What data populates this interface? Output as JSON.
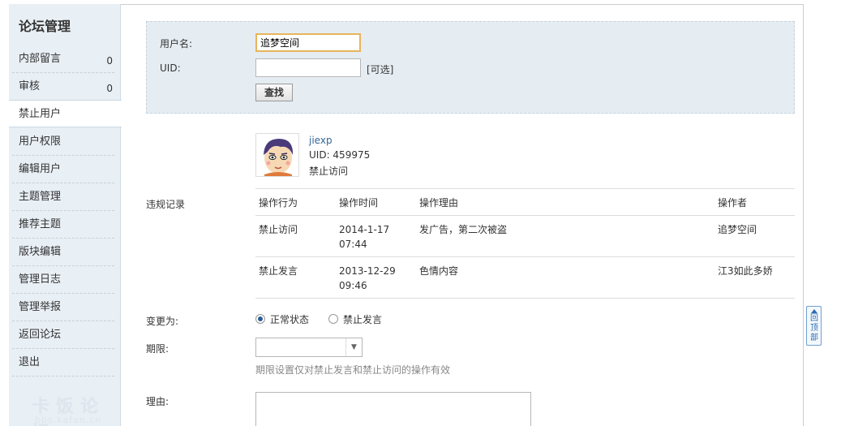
{
  "sidebar": {
    "title": "论坛管理",
    "items": [
      {
        "label": "内部留言",
        "count": "0"
      },
      {
        "label": "审核",
        "count": "0"
      },
      {
        "label": "禁止用户"
      },
      {
        "label": "用户权限"
      },
      {
        "label": "编辑用户"
      },
      {
        "label": "主题管理"
      },
      {
        "label": "推荐主题"
      },
      {
        "label": "版块编辑"
      },
      {
        "label": "管理日志"
      },
      {
        "label": "管理举报"
      },
      {
        "label": "返回论坛"
      },
      {
        "label": "退出"
      }
    ],
    "active_item": "禁止用户",
    "watermark": "卡饭论坛",
    "watermark_url": "bbs.kafan.cn"
  },
  "search": {
    "username_label": "用户名:",
    "username_value": "追梦空间",
    "uid_label": "UID:",
    "uid_value": "",
    "uid_hint": "[可选]",
    "search_button": "查找"
  },
  "user": {
    "name": "jiexp",
    "uid": "UID: 459975",
    "status": "禁止访问"
  },
  "records": {
    "section_label": "违规记录",
    "columns": [
      "操作行为",
      "操作时间",
      "操作理由",
      "操作者"
    ],
    "rows": [
      {
        "action": "禁止访问",
        "date": "2014-1-17",
        "time": "07:44",
        "reason": "发广告，第二次被盗",
        "operator": "追梦空间"
      },
      {
        "action": "禁止发言",
        "date": "2013-12-29",
        "time": "09:46",
        "reason": "色情内容",
        "operator": "江3如此多娇"
      }
    ]
  },
  "form": {
    "change_label": "变更为:",
    "options": [
      "正常状态",
      "禁止发言"
    ],
    "selected_option": "正常状态",
    "period_label": "期限:",
    "period_value": "",
    "period_hint": "期限设置仅对禁止发言和禁止访问的操作有效",
    "reason_label": "理由:"
  },
  "back_to_top": "回顶部",
  "colors": {
    "link": "#336699",
    "sidebar_bg": "#e8eff5",
    "panel_bg": "#e5edf3",
    "focus_border": "#e8b45a"
  }
}
